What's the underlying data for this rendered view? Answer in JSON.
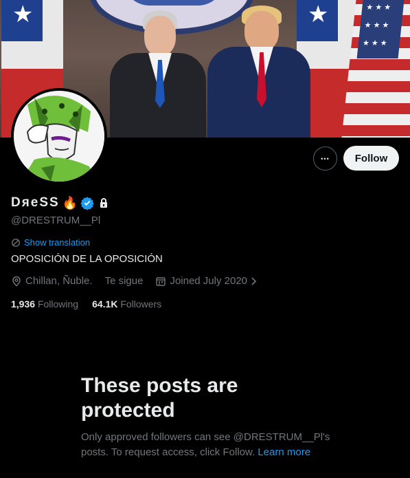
{
  "profile": {
    "name": "DяeSS",
    "name_emoji": "🔥",
    "handle": "@DRESTRUM__Pl",
    "verified": true,
    "locked": true,
    "bio": "OPOSICIÓN DE LA OPOSICIÓN",
    "location": "Chillan, Ñuble.",
    "follows_you": "Te sigue",
    "joined": "Joined July 2020",
    "following_count": "1,936",
    "following_label": "Following",
    "followers_count": "64.1K",
    "followers_label": "Followers"
  },
  "actions": {
    "more_label": "•••",
    "follow_label": "Follow",
    "show_translation": "Show translation"
  },
  "protected": {
    "title_line1": "These posts are",
    "title_line2": "protected",
    "text_line1": "Only approved followers can see @DRESTRUM__Pl's",
    "text_line2": "posts. To request access, click Follow.",
    "learn_more": "Learn more"
  },
  "colors": {
    "background": "#000000",
    "accent": "#1d9bf0",
    "muted": "#71767b",
    "text": "#e7e9ea",
    "verified_badge": "#1d9bf0"
  },
  "icons": [
    "more-icon",
    "verified-icon",
    "lock-icon",
    "translate-icon",
    "location-icon",
    "calendar-icon",
    "chevron-right-icon"
  ]
}
